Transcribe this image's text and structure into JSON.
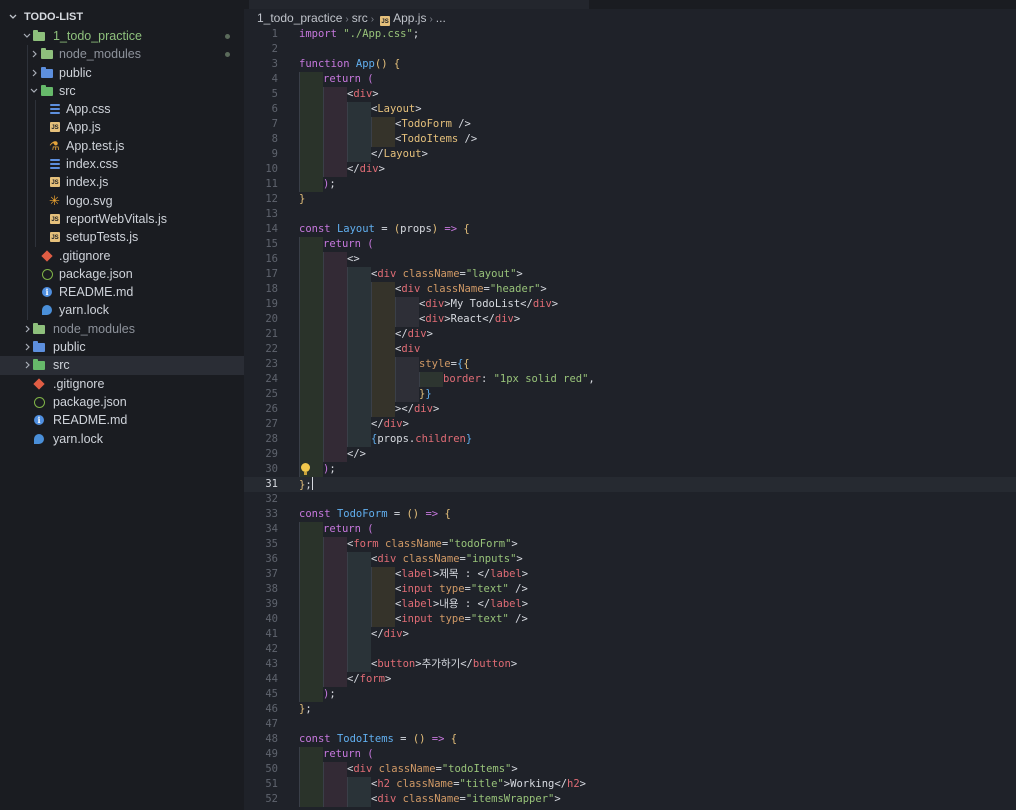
{
  "explorer": {
    "title": "TODO-LIST",
    "items": [
      {
        "label": "1_todo_practice",
        "indent": 1,
        "chevron": "down",
        "icon": "folder-open",
        "color": "green",
        "dot": true
      },
      {
        "label": "node_modules",
        "indent": 2,
        "chevron": "right",
        "icon": "folder-node",
        "color": "dim",
        "dot": true
      },
      {
        "label": "public",
        "indent": 2,
        "chevron": "right",
        "icon": "folder-public"
      },
      {
        "label": "src",
        "indent": 2,
        "chevron": "down",
        "icon": "folder-src"
      },
      {
        "label": "App.css",
        "indent": 3,
        "icon": "css-file"
      },
      {
        "label": "App.js",
        "indent": 3,
        "icon": "js-file"
      },
      {
        "label": "App.test.js",
        "indent": 3,
        "icon": "test-file"
      },
      {
        "label": "index.css",
        "indent": 3,
        "icon": "css-file"
      },
      {
        "label": "index.js",
        "indent": 3,
        "icon": "js-file"
      },
      {
        "label": "logo.svg",
        "indent": 3,
        "icon": "svg-file"
      },
      {
        "label": "reportWebVitals.js",
        "indent": 3,
        "icon": "js-file"
      },
      {
        "label": "setupTests.js",
        "indent": 3,
        "icon": "js-file"
      },
      {
        "label": ".gitignore",
        "indent": 2,
        "icon": "git-file"
      },
      {
        "label": "package.json",
        "indent": 2,
        "icon": "package-file"
      },
      {
        "label": "README.md",
        "indent": 2,
        "icon": "info-file"
      },
      {
        "label": "yarn.lock",
        "indent": 2,
        "icon": "yarn-file"
      },
      {
        "label": "node_modules",
        "indent": 1,
        "chevron": "right",
        "icon": "folder-node",
        "color": "dim"
      },
      {
        "label": "public",
        "indent": 1,
        "chevron": "right",
        "icon": "folder-public"
      },
      {
        "label": "src",
        "indent": 1,
        "chevron": "right",
        "icon": "folder-src",
        "selected": true
      },
      {
        "label": ".gitignore",
        "indent": 1,
        "icon": "git-file"
      },
      {
        "label": "package.json",
        "indent": 1,
        "icon": "package-file"
      },
      {
        "label": "README.md",
        "indent": 1,
        "icon": "info-file"
      },
      {
        "label": "yarn.lock",
        "indent": 1,
        "icon": "yarn-file"
      }
    ]
  },
  "breadcrumbs": [
    "1_todo_practice",
    "src",
    "App.js",
    "..."
  ],
  "editor": {
    "current_line": 31,
    "lightbulb_line": 30,
    "lines": [
      {
        "n": "1",
        "g": 0,
        "tok": [
          [
            "k",
            "import "
          ],
          [
            "s",
            "\"./App.css\""
          ],
          [
            "pl",
            ";"
          ]
        ]
      },
      {
        "n": "2",
        "g": 0,
        "tok": []
      },
      {
        "n": "3",
        "g": 0,
        "tok": [
          [
            "k",
            "function "
          ],
          [
            "f",
            "App"
          ],
          [
            "c",
            "() {"
          ]
        ]
      },
      {
        "n": "4",
        "g": 1,
        "tok": [
          [
            "k",
            "return "
          ],
          [
            "p",
            "("
          ]
        ]
      },
      {
        "n": "5",
        "g": 2,
        "tok": [
          [
            "pl",
            "<"
          ],
          [
            "t",
            "div"
          ],
          [
            "pl",
            ">"
          ]
        ]
      },
      {
        "n": "6",
        "g": 3,
        "tok": [
          [
            "pl",
            "<"
          ],
          [
            "c",
            "Layout"
          ],
          [
            "pl",
            ">"
          ]
        ]
      },
      {
        "n": "7",
        "g": 4,
        "tok": [
          [
            "pl",
            "<"
          ],
          [
            "c",
            "TodoForm"
          ],
          [
            "pl",
            " />"
          ]
        ]
      },
      {
        "n": "8",
        "g": 4,
        "tok": [
          [
            "pl",
            "<"
          ],
          [
            "c",
            "TodoItems"
          ],
          [
            "pl",
            " />"
          ]
        ]
      },
      {
        "n": "9",
        "g": 3,
        "tok": [
          [
            "pl",
            "</"
          ],
          [
            "c",
            "Layout"
          ],
          [
            "pl",
            ">"
          ]
        ]
      },
      {
        "n": "10",
        "g": 2,
        "tok": [
          [
            "pl",
            "</"
          ],
          [
            "t",
            "div"
          ],
          [
            "pl",
            ">"
          ]
        ]
      },
      {
        "n": "11",
        "g": 1,
        "tok": [
          [
            "p",
            ")"
          ],
          [
            "pl",
            ";"
          ]
        ]
      },
      {
        "n": "12",
        "g": 0,
        "tok": [
          [
            "c",
            "}"
          ]
        ]
      },
      {
        "n": "13",
        "g": 0,
        "tok": []
      },
      {
        "n": "14",
        "g": 0,
        "tok": [
          [
            "k",
            "const "
          ],
          [
            "f",
            "Layout"
          ],
          [
            "pl",
            " = "
          ],
          [
            "c",
            "("
          ],
          [
            "pl",
            "props"
          ],
          [
            "c",
            ")"
          ],
          [
            "k",
            " => "
          ],
          [
            "c",
            "{"
          ]
        ]
      },
      {
        "n": "15",
        "g": 1,
        "tok": [
          [
            "k",
            "return "
          ],
          [
            "p",
            "("
          ]
        ]
      },
      {
        "n": "16",
        "g": 2,
        "tok": [
          [
            "pl",
            "<>"
          ]
        ]
      },
      {
        "n": "17",
        "g": 3,
        "tok": [
          [
            "pl",
            "<"
          ],
          [
            "t",
            "div"
          ],
          [
            "a",
            " className"
          ],
          [
            "pl",
            "="
          ],
          [
            "s",
            "\"layout\""
          ],
          [
            "pl",
            ">"
          ]
        ]
      },
      {
        "n": "18",
        "g": 4,
        "tok": [
          [
            "pl",
            "<"
          ],
          [
            "t",
            "div"
          ],
          [
            "a",
            " className"
          ],
          [
            "pl",
            "="
          ],
          [
            "s",
            "\"header\""
          ],
          [
            "pl",
            ">"
          ]
        ]
      },
      {
        "n": "19",
        "g": 5,
        "tok": [
          [
            "pl",
            "<"
          ],
          [
            "t",
            "div"
          ],
          [
            "pl",
            ">My TodoList</"
          ],
          [
            "t",
            "div"
          ],
          [
            "pl",
            ">"
          ]
        ]
      },
      {
        "n": "20",
        "g": 5,
        "tok": [
          [
            "pl",
            "<"
          ],
          [
            "t",
            "div"
          ],
          [
            "pl",
            ">React</"
          ],
          [
            "t",
            "div"
          ],
          [
            "pl",
            ">"
          ]
        ]
      },
      {
        "n": "21",
        "g": 4,
        "tok": [
          [
            "pl",
            "</"
          ],
          [
            "t",
            "div"
          ],
          [
            "pl",
            ">"
          ]
        ]
      },
      {
        "n": "22",
        "g": 4,
        "tok": [
          [
            "pl",
            "<"
          ],
          [
            "t",
            "div"
          ]
        ]
      },
      {
        "n": "23",
        "g": 5,
        "tok": [
          [
            "a",
            "style"
          ],
          [
            "pl",
            "="
          ],
          [
            "f",
            "{"
          ],
          [
            "c",
            "{"
          ]
        ]
      },
      {
        "n": "24",
        "g": 6,
        "tok": [
          [
            "v",
            "border"
          ],
          [
            "pl",
            ": "
          ],
          [
            "s",
            "\"1px solid red\""
          ],
          [
            "pl",
            ","
          ]
        ]
      },
      {
        "n": "25",
        "g": 5,
        "tok": [
          [
            "c",
            "}"
          ],
          [
            "f",
            "}"
          ]
        ]
      },
      {
        "n": "26",
        "g": 4,
        "tok": [
          [
            "pl",
            "></"
          ],
          [
            "t",
            "div"
          ],
          [
            "pl",
            ">"
          ]
        ]
      },
      {
        "n": "27",
        "g": 3,
        "tok": [
          [
            "pl",
            "</"
          ],
          [
            "t",
            "div"
          ],
          [
            "pl",
            ">"
          ]
        ]
      },
      {
        "n": "28",
        "g": 3,
        "tok": [
          [
            "f",
            "{"
          ],
          [
            "pl",
            "props."
          ],
          [
            "v",
            "children"
          ],
          [
            "f",
            "}"
          ]
        ]
      },
      {
        "n": "29",
        "g": 2,
        "tok": [
          [
            "pl",
            "</>"
          ]
        ]
      },
      {
        "n": "30",
        "g": 1,
        "tok": [
          [
            "p",
            ")"
          ],
          [
            "pl",
            ";"
          ]
        ]
      },
      {
        "n": "31",
        "g": 0,
        "tok": [
          [
            "c",
            "}"
          ],
          [
            "pl",
            ";"
          ]
        ]
      },
      {
        "n": "32",
        "g": 0,
        "tok": []
      },
      {
        "n": "33",
        "g": 0,
        "tok": [
          [
            "k",
            "const "
          ],
          [
            "f",
            "TodoForm"
          ],
          [
            "pl",
            " = "
          ],
          [
            "c",
            "()"
          ],
          [
            "k",
            " => "
          ],
          [
            "c",
            "{"
          ]
        ]
      },
      {
        "n": "34",
        "g": 1,
        "tok": [
          [
            "k",
            "return "
          ],
          [
            "p",
            "("
          ]
        ]
      },
      {
        "n": "35",
        "g": 2,
        "tok": [
          [
            "pl",
            "<"
          ],
          [
            "t",
            "form"
          ],
          [
            "a",
            " className"
          ],
          [
            "pl",
            "="
          ],
          [
            "s",
            "\"todoForm\""
          ],
          [
            "pl",
            ">"
          ]
        ]
      },
      {
        "n": "36",
        "g": 3,
        "tok": [
          [
            "pl",
            "<"
          ],
          [
            "t",
            "div"
          ],
          [
            "a",
            " className"
          ],
          [
            "pl",
            "="
          ],
          [
            "s",
            "\"inputs\""
          ],
          [
            "pl",
            ">"
          ]
        ]
      },
      {
        "n": "37",
        "g": 4,
        "tok": [
          [
            "pl",
            "<"
          ],
          [
            "t",
            "label"
          ],
          [
            "pl",
            ">제목 : </"
          ],
          [
            "t",
            "label"
          ],
          [
            "pl",
            ">"
          ]
        ]
      },
      {
        "n": "38",
        "g": 4,
        "tok": [
          [
            "pl",
            "<"
          ],
          [
            "t",
            "input"
          ],
          [
            "a",
            " type"
          ],
          [
            "pl",
            "="
          ],
          [
            "s",
            "\"text\""
          ],
          [
            "pl",
            " />"
          ]
        ]
      },
      {
        "n": "39",
        "g": 4,
        "tok": [
          [
            "pl",
            "<"
          ],
          [
            "t",
            "label"
          ],
          [
            "pl",
            ">내용 : </"
          ],
          [
            "t",
            "label"
          ],
          [
            "pl",
            ">"
          ]
        ]
      },
      {
        "n": "40",
        "g": 4,
        "tok": [
          [
            "pl",
            "<"
          ],
          [
            "t",
            "input"
          ],
          [
            "a",
            " type"
          ],
          [
            "pl",
            "="
          ],
          [
            "s",
            "\"text\""
          ],
          [
            "pl",
            " />"
          ]
        ]
      },
      {
        "n": "41",
        "g": 3,
        "tok": [
          [
            "pl",
            "</"
          ],
          [
            "t",
            "div"
          ],
          [
            "pl",
            ">"
          ]
        ]
      },
      {
        "n": "42",
        "g": 3,
        "tok": []
      },
      {
        "n": "43",
        "g": 3,
        "tok": [
          [
            "pl",
            "<"
          ],
          [
            "t",
            "button"
          ],
          [
            "pl",
            ">추가하기</"
          ],
          [
            "t",
            "button"
          ],
          [
            "pl",
            ">"
          ]
        ]
      },
      {
        "n": "44",
        "g": 2,
        "tok": [
          [
            "pl",
            "</"
          ],
          [
            "t",
            "form"
          ],
          [
            "pl",
            ">"
          ]
        ]
      },
      {
        "n": "45",
        "g": 1,
        "tok": [
          [
            "p",
            ")"
          ],
          [
            "pl",
            ";"
          ]
        ]
      },
      {
        "n": "46",
        "g": 0,
        "tok": [
          [
            "c",
            "}"
          ],
          [
            "pl",
            ";"
          ]
        ]
      },
      {
        "n": "47",
        "g": 0,
        "tok": []
      },
      {
        "n": "48",
        "g": 0,
        "tok": [
          [
            "k",
            "const "
          ],
          [
            "f",
            "TodoItems"
          ],
          [
            "pl",
            " = "
          ],
          [
            "c",
            "()"
          ],
          [
            "k",
            " => "
          ],
          [
            "c",
            "{"
          ]
        ]
      },
      {
        "n": "49",
        "g": 1,
        "tok": [
          [
            "k",
            "return "
          ],
          [
            "p",
            "("
          ]
        ]
      },
      {
        "n": "50",
        "g": 2,
        "tok": [
          [
            "pl",
            "<"
          ],
          [
            "t",
            "div"
          ],
          [
            "a",
            " className"
          ],
          [
            "pl",
            "="
          ],
          [
            "s",
            "\"todoItems\""
          ],
          [
            "pl",
            ">"
          ]
        ]
      },
      {
        "n": "51",
        "g": 3,
        "tok": [
          [
            "pl",
            "<"
          ],
          [
            "t",
            "h2"
          ],
          [
            "a",
            " className"
          ],
          [
            "pl",
            "="
          ],
          [
            "s",
            "\"title\""
          ],
          [
            "pl",
            ">Working</"
          ],
          [
            "t",
            "h2"
          ],
          [
            "pl",
            ">"
          ]
        ]
      },
      {
        "n": "52",
        "g": 3,
        "tok": [
          [
            "pl",
            "<"
          ],
          [
            "t",
            "div"
          ],
          [
            "a",
            " className"
          ],
          [
            "pl",
            "="
          ],
          [
            "s",
            "\"itemsWrapper\""
          ],
          [
            "pl",
            ">"
          ]
        ]
      }
    ]
  }
}
